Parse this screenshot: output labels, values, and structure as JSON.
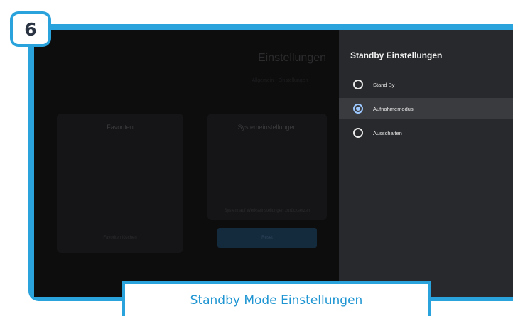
{
  "step_badge": "6",
  "background_screen": {
    "title": "Einstellungen",
    "subtitle": "Allgemein · Einstellungen",
    "card_left": {
      "title": "Favoriten",
      "footer": "Favoriten löschen"
    },
    "card_right": {
      "title": "Systemeinstellungen",
      "footer": "System auf Werkseinstellungen zurücksetzen",
      "button_label": "Reset"
    }
  },
  "standby_panel": {
    "title": "Standby Einstellungen",
    "options": [
      {
        "label": "Stand By",
        "selected": false
      },
      {
        "label": "Aufnahmemodus",
        "selected": true
      },
      {
        "label": "Ausschalten",
        "selected": false
      }
    ]
  },
  "caption": "Standby Mode Einstellungen",
  "colors": {
    "frame_blue": "#2aa3dc",
    "panel_bg": "#28292c",
    "selected_radio": "#9cc8ff",
    "caption_text": "#1e95d2"
  }
}
